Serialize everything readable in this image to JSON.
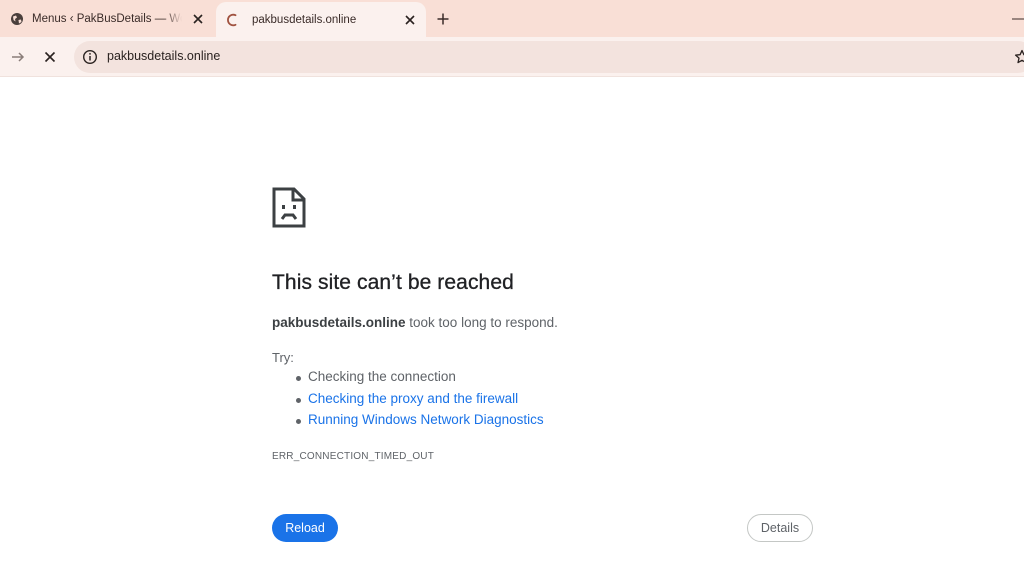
{
  "browser": {
    "tabs": [
      {
        "title": "Menus ‹ PakBusDetails — WordPress",
        "icon": "globe-icon",
        "active": false
      },
      {
        "title": "pakbusdetails.online",
        "icon": "loading-spinner-icon",
        "active": true
      }
    ],
    "new_tab_icon": "plus-icon",
    "close_icon": "close-icon",
    "minimize_icon": "minimize-icon"
  },
  "toolbar": {
    "forward_icon": "arrow-right-icon",
    "stop_icon": "close-icon",
    "site_info_icon": "info-icon",
    "url": "pakbusdetails.online",
    "bookmark_icon": "star-icon"
  },
  "error": {
    "icon": "sad-page-icon",
    "title": "This site can’t be reached",
    "host": "pakbusdetails.online",
    "message": " took too long to respond.",
    "try_label": "Try:",
    "suggestions": [
      {
        "text": "Checking the connection",
        "link": false
      },
      {
        "text": "Checking the proxy and the firewall",
        "link": true
      },
      {
        "text": "Running Windows Network Diagnostics",
        "link": true
      }
    ],
    "code": "ERR_CONNECTION_TIMED_OUT",
    "reload_label": "Reload",
    "details_label": "Details"
  },
  "colors": {
    "tabstrip": "#f9dfd6",
    "toolbar": "#fbf1ee",
    "accent": "#1a73e8",
    "text_secondary": "#5f6368"
  }
}
